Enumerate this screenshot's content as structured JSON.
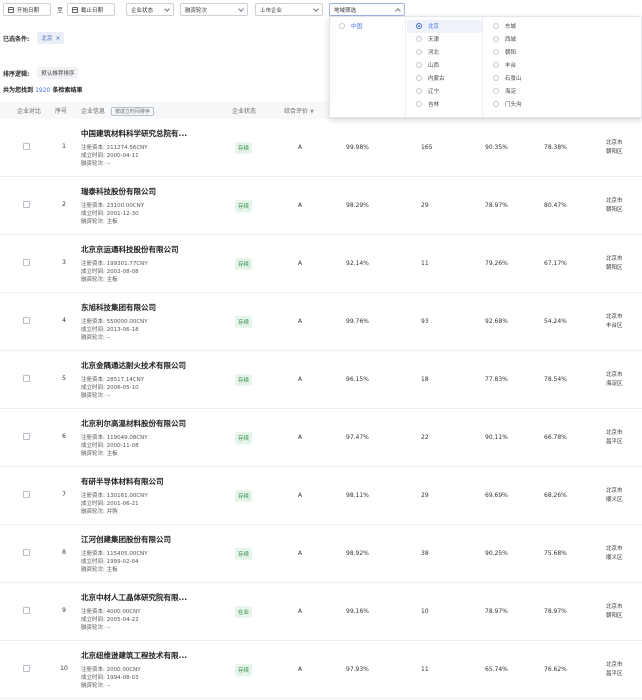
{
  "filters": {
    "start_date": "开始日期",
    "to": "至",
    "end_date": "截止日期",
    "company_status": "企业状态",
    "funding_round": "融资轮次",
    "listed": "上市企业",
    "region": "地域筛选"
  },
  "selected": {
    "label": "已选条件:",
    "tag": "北京"
  },
  "sort": {
    "label": "排序逻辑:",
    "value": "默认推荐排序"
  },
  "count": {
    "prefix": "共为您找到",
    "number": "1920",
    "suffix": "条检索结果"
  },
  "table": {
    "headers": {
      "compare": "企业对比",
      "index": "序号",
      "info": "企业信息",
      "sort_btn": "按成立时间排序",
      "status": "企业状态",
      "rating": "综合评价",
      "influence": "影响",
      "region": "地域"
    },
    "rows": [
      {
        "idx": "1",
        "name": "中国建筑材料科学研究总院有...",
        "capital": "注册资本: 211274.56CNY",
        "founded": "成立时间: 2000-04-11",
        "round": "融资轮次: --",
        "status": "存续",
        "grade": "A",
        "v1": "99.98%",
        "v2": "165",
        "v3": "90.35%",
        "v4": "78.38%",
        "r1": "北京市",
        "r2": "朝阳区"
      },
      {
        "idx": "2",
        "name": "瑞泰科技股份有限公司",
        "capital": "注册资本: 23100.00CNY",
        "founded": "成立时间: 2001-12-30",
        "round": "融资轮次: 主板",
        "status": "存续",
        "grade": "A",
        "v1": "98.29%",
        "v2": "29",
        "v3": "78.97%",
        "v4": "80.47%",
        "r1": "北京市",
        "r2": "朝阳区"
      },
      {
        "idx": "3",
        "name": "北京京运通科技股份有限公司",
        "capital": "注册资本: 199301.77CNY",
        "founded": "成立时间: 2002-08-08",
        "round": "融资轮次: 主板",
        "status": "存续",
        "grade": "A",
        "v1": "92.14%",
        "v2": "11",
        "v3": "79.26%",
        "v4": "67.17%",
        "r1": "北京市",
        "r2": "朝阳区"
      },
      {
        "idx": "4",
        "name": "东旭科技集团有限公司",
        "capital": "注册资本: 550000.00CNY",
        "founded": "成立时间: 2013-06-18",
        "round": "融资轮次: --",
        "status": "存续",
        "grade": "A",
        "v1": "99.76%",
        "v2": "93",
        "v3": "92.68%",
        "v4": "54.24%",
        "r1": "北京市",
        "r2": "丰台区"
      },
      {
        "idx": "5",
        "name": "北京金隅通达耐火技术有限公司",
        "capital": "注册资本: 28517.14CNY",
        "founded": "成立时间: 2006-05-10",
        "round": "融资轮次: --",
        "status": "存续",
        "grade": "A",
        "v1": "96.15%",
        "v2": "18",
        "v3": "77.83%",
        "v4": "78.54%",
        "r1": "北京市",
        "r2": "海淀区"
      },
      {
        "idx": "6",
        "name": "北京利尔高温材料股份有限公司",
        "capital": "注册资本: 119049.08CNY",
        "founded": "成立时间: 2000-11-08",
        "round": "融资轮次: 主板",
        "status": "存续",
        "grade": "A",
        "v1": "97.47%",
        "v2": "22",
        "v3": "90.11%",
        "v4": "66.78%",
        "r1": "北京市",
        "r2": "昌平区"
      },
      {
        "idx": "7",
        "name": "有研半导体材料有限公司",
        "capital": "注册资本: 130161.00CNY",
        "founded": "成立时间: 2001-06-21",
        "round": "融资轮次: 并购",
        "status": "存续",
        "grade": "A",
        "v1": "98.11%",
        "v2": "29",
        "v3": "69.69%",
        "v4": "68.26%",
        "r1": "北京市",
        "r2": "顺义区"
      },
      {
        "idx": "8",
        "name": "江河创建集团股份有限公司",
        "capital": "注册资本: 115405.00CNY",
        "founded": "成立时间: 1999-02-04",
        "round": "融资轮次: 主板",
        "status": "存续",
        "grade": "A",
        "v1": "98.92%",
        "v2": "38",
        "v3": "90.25%",
        "v4": "75.68%",
        "r1": "北京市",
        "r2": "顺义区"
      },
      {
        "idx": "9",
        "name": "北京中材人工晶体研究院有限...",
        "capital": "注册资本: 4000.00CNY",
        "founded": "成立时间: 2005-04-22",
        "round": "融资轮次: --",
        "status": "在业",
        "grade": "A",
        "v1": "99.16%",
        "v2": "10",
        "v3": "78.97%",
        "v4": "78.97%",
        "r1": "北京市",
        "r2": "朝阳区"
      },
      {
        "idx": "10",
        "name": "北京纽维逊建筑工程技术有限...",
        "capital": "注册资本: 2000.00CNY",
        "founded": "成立时间: 1994-08-03",
        "round": "融资轮次: --",
        "status": "存续",
        "grade": "A",
        "v1": "97.93%",
        "v2": "11",
        "v3": "65.74%",
        "v4": "76.62%",
        "r1": "北京市",
        "r2": "昌平区"
      }
    ]
  },
  "dropdown": {
    "col1": [
      "中国"
    ],
    "col2": [
      "北京",
      "天津",
      "河北",
      "山西",
      "内蒙古",
      "辽宁",
      "吉林"
    ],
    "col3": [
      "东城",
      "西城",
      "朝阳",
      "丰台",
      "石景山",
      "海淀",
      "门头沟"
    ]
  }
}
